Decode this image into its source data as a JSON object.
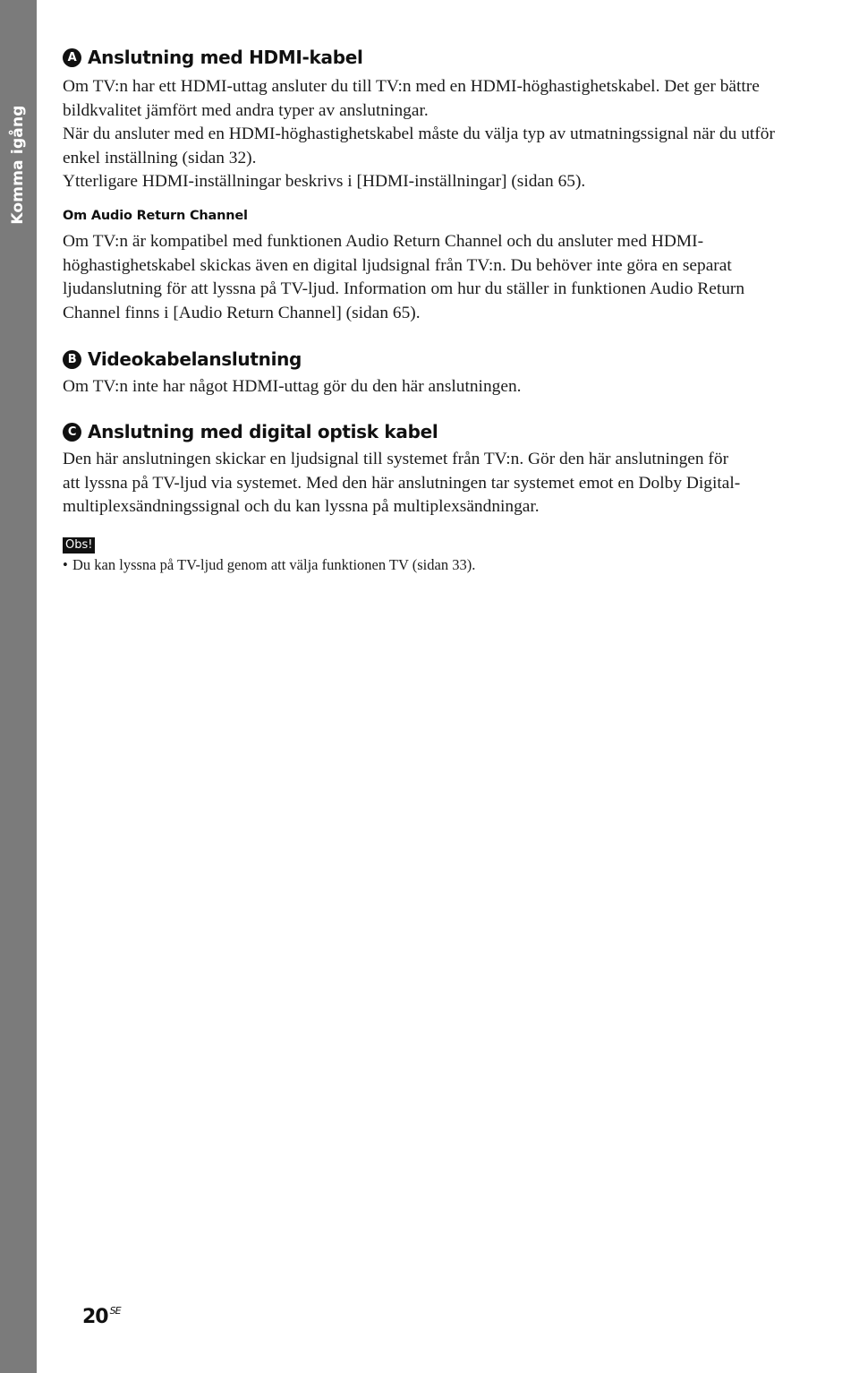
{
  "side_tab": {
    "label": "Komma igång"
  },
  "sections": [
    {
      "badge": "A",
      "title": "Anslutning med HDMI-kabel",
      "lines": [
        "Om TV:n har ett HDMI-uttag ansluter du till TV:n med en HDMI-höghastighetskabel. Det ger bättre",
        "bildkvalitet jämfört med andra typer av anslutningar.",
        "När du ansluter med en HDMI-höghastighetskabel måste du välja typ av utmatningssignal när du utför",
        "enkel inställning (sidan 32).",
        "Ytterligare HDMI-inställningar beskrivs i [HDMI-inställningar] (sidan 65)."
      ],
      "subsection": {
        "title": "Om Audio Return Channel",
        "lines": [
          "Om TV:n är kompatibel med funktionen Audio Return Channel och du ansluter med HDMI-",
          "höghastighetskabel skickas även en digital ljudsignal från TV:n. Du behöver inte göra en separat",
          "ljudanslutning för att lyssna på TV-ljud. Information om hur du ställer in funktionen Audio Return",
          "Channel finns i [Audio Return Channel] (sidan 65)."
        ]
      }
    },
    {
      "badge": "B",
      "title": "Videokabelanslutning",
      "lines": [
        "Om TV:n inte har något HDMI-uttag gör du den här anslutningen."
      ]
    },
    {
      "badge": "C",
      "title": "Anslutning med digital optisk kabel",
      "lines": [
        "Den här anslutningen skickar en ljudsignal till systemet från TV:n. Gör den här anslutningen för",
        "att lyssna på TV-ljud via systemet. Med den här anslutningen tar systemet emot en Dolby Digital-",
        "multiplexsändningssignal och du kan lyssna på multiplexsändningar."
      ]
    }
  ],
  "note": {
    "label": "Obs!",
    "items": [
      "Du kan lyssna på TV-ljud genom att välja funktionen TV (sidan 33)."
    ]
  },
  "footer": {
    "page_number": "20",
    "region_suffix": "SE"
  }
}
